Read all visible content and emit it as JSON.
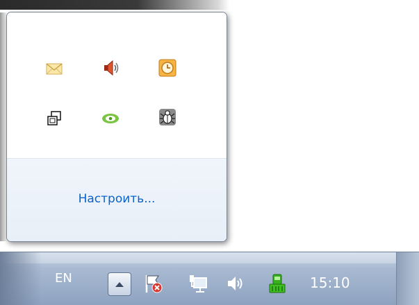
{
  "popup": {
    "icons": [
      {
        "name": "mail-icon",
        "row": 0,
        "col": 0
      },
      {
        "name": "speaker-muted-icon",
        "row": 0,
        "col": 1
      },
      {
        "name": "clock-app-icon",
        "row": 0,
        "col": 2
      },
      {
        "name": "windows-overlap-icon",
        "row": 1,
        "col": 0
      },
      {
        "name": "nvidia-icon",
        "row": 1,
        "col": 1
      },
      {
        "name": "bug-icon",
        "row": 1,
        "col": 2
      }
    ],
    "customize_label": "Настроить..."
  },
  "taskbar": {
    "language": "EN",
    "show_hidden_icon": "triangle-up-icon",
    "tray_icons": [
      "action-center-flag-icon",
      "network-icon",
      "volume-icon",
      "green-app-icon"
    ],
    "time": "15:10"
  },
  "colors": {
    "link": "#0a62c9",
    "taskbar": "#a9bad2"
  }
}
